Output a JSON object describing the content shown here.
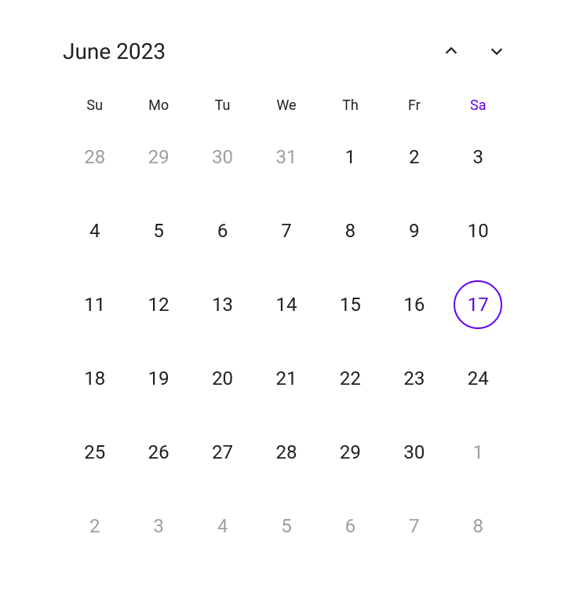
{
  "calendar": {
    "title": "June 2023",
    "accent_color": "#6200ee",
    "weekdays": [
      {
        "label": "Su",
        "is_today_col": false
      },
      {
        "label": "Mo",
        "is_today_col": false
      },
      {
        "label": "Tu",
        "is_today_col": false
      },
      {
        "label": "We",
        "is_today_col": false
      },
      {
        "label": "Th",
        "is_today_col": false
      },
      {
        "label": "Fr",
        "is_today_col": false
      },
      {
        "label": "Sa",
        "is_today_col": true
      }
    ],
    "days": [
      {
        "num": "28",
        "other": true,
        "today": false
      },
      {
        "num": "29",
        "other": true,
        "today": false
      },
      {
        "num": "30",
        "other": true,
        "today": false
      },
      {
        "num": "31",
        "other": true,
        "today": false
      },
      {
        "num": "1",
        "other": false,
        "today": false
      },
      {
        "num": "2",
        "other": false,
        "today": false
      },
      {
        "num": "3",
        "other": false,
        "today": false
      },
      {
        "num": "4",
        "other": false,
        "today": false
      },
      {
        "num": "5",
        "other": false,
        "today": false
      },
      {
        "num": "6",
        "other": false,
        "today": false
      },
      {
        "num": "7",
        "other": false,
        "today": false
      },
      {
        "num": "8",
        "other": false,
        "today": false
      },
      {
        "num": "9",
        "other": false,
        "today": false
      },
      {
        "num": "10",
        "other": false,
        "today": false
      },
      {
        "num": "11",
        "other": false,
        "today": false
      },
      {
        "num": "12",
        "other": false,
        "today": false
      },
      {
        "num": "13",
        "other": false,
        "today": false
      },
      {
        "num": "14",
        "other": false,
        "today": false
      },
      {
        "num": "15",
        "other": false,
        "today": false
      },
      {
        "num": "16",
        "other": false,
        "today": false
      },
      {
        "num": "17",
        "other": false,
        "today": true
      },
      {
        "num": "18",
        "other": false,
        "today": false
      },
      {
        "num": "19",
        "other": false,
        "today": false
      },
      {
        "num": "20",
        "other": false,
        "today": false
      },
      {
        "num": "21",
        "other": false,
        "today": false
      },
      {
        "num": "22",
        "other": false,
        "today": false
      },
      {
        "num": "23",
        "other": false,
        "today": false
      },
      {
        "num": "24",
        "other": false,
        "today": false
      },
      {
        "num": "25",
        "other": false,
        "today": false
      },
      {
        "num": "26",
        "other": false,
        "today": false
      },
      {
        "num": "27",
        "other": false,
        "today": false
      },
      {
        "num": "28",
        "other": false,
        "today": false
      },
      {
        "num": "29",
        "other": false,
        "today": false
      },
      {
        "num": "30",
        "other": false,
        "today": false
      },
      {
        "num": "1",
        "other": true,
        "today": false
      },
      {
        "num": "2",
        "other": true,
        "today": false
      },
      {
        "num": "3",
        "other": true,
        "today": false
      },
      {
        "num": "4",
        "other": true,
        "today": false
      },
      {
        "num": "5",
        "other": true,
        "today": false
      },
      {
        "num": "6",
        "other": true,
        "today": false
      },
      {
        "num": "7",
        "other": true,
        "today": false
      },
      {
        "num": "8",
        "other": true,
        "today": false
      }
    ]
  }
}
